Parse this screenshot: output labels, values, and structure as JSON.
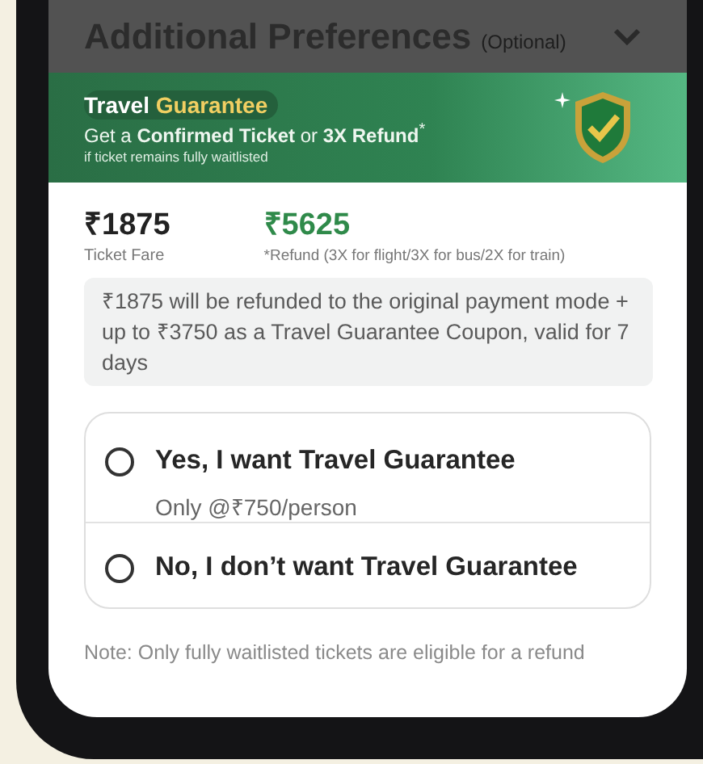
{
  "header": {
    "title": "Additional Preferences",
    "note": "(Optional)"
  },
  "banner": {
    "title": "Travel",
    "title_highlight": "Guarantee",
    "subtitle": "Get a **Confirmed Ticket** or **3X Refund**$^{*}$",
    "caption": "if ticket remains fully waitlisted"
  },
  "prices": [
    {
      "kind": "fare",
      "amount": "₹1875",
      "label": "Ticket Fare"
    },
    {
      "kind": "refund",
      "amount": "₹5625",
      "label": "*Refund (3X for flight/3X for bus/2X for train)"
    }
  ],
  "info": "₹1875 will be refunded to the original payment mode + up to ₹3750 as a Travel Guarantee Coupon, valid for 7 days",
  "options": [
    {
      "label": "Yes, I want Travel Guarantee",
      "detail": "Only @₹750/person",
      "selected": false
    },
    {
      "label": "No, I don’t want Travel Guarantee",
      "selected": false
    }
  ],
  "note": "Note: Only fully waitlisted tickets are eligible for a refund"
}
